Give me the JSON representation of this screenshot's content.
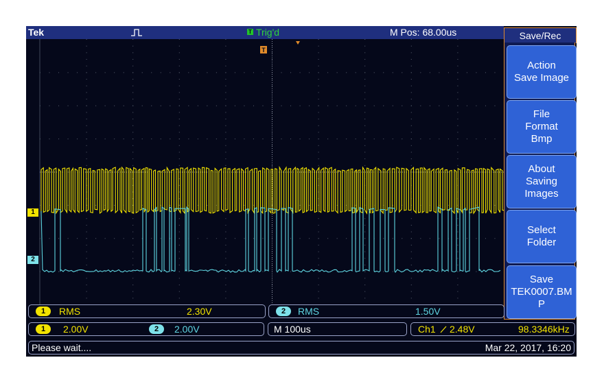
{
  "top_bar": {
    "brand": "Tek",
    "acquisition_icon": "pulse-run-icon",
    "trigger_marker_label": "T",
    "trigger_status": "Trig'd",
    "horizontal_position": "M Pos: 68.00us"
  },
  "trigger_position_marker": "T",
  "channel_markers": {
    "ch1": "1",
    "ch2": "2"
  },
  "menu": {
    "title": "Save/Rec",
    "buttons": [
      {
        "label": "Action\nSave Image"
      },
      {
        "label": "File\nFormat\nBmp"
      },
      {
        "label": "About\nSaving\nImages"
      },
      {
        "label": "Select\nFolder"
      },
      {
        "label": "Save\nTEK0007.BM\nP"
      }
    ]
  },
  "measurements": {
    "ch1": {
      "badge": "1",
      "name": "RMS",
      "value": "2.30V"
    },
    "ch2": {
      "badge": "2",
      "name": "RMS",
      "value": "1.50V"
    }
  },
  "vertical": {
    "ch1": {
      "badge": "1",
      "scale": "2.00V"
    },
    "ch2": {
      "badge": "2",
      "scale": "2.00V"
    }
  },
  "timebase": "M 100us",
  "trigger": {
    "source": "Ch1",
    "slope_icon": "rising-edge-icon",
    "level": "2.48V",
    "frequency": "98.3346kHz"
  },
  "status": {
    "message": "Please wait....",
    "datetime": "Mar 22, 2017, 16:20"
  },
  "colors": {
    "ch1": "#f2e300",
    "ch2": "#5fd6e2",
    "accent": "#e08a2a",
    "menu_button": "#2f62d6"
  }
}
